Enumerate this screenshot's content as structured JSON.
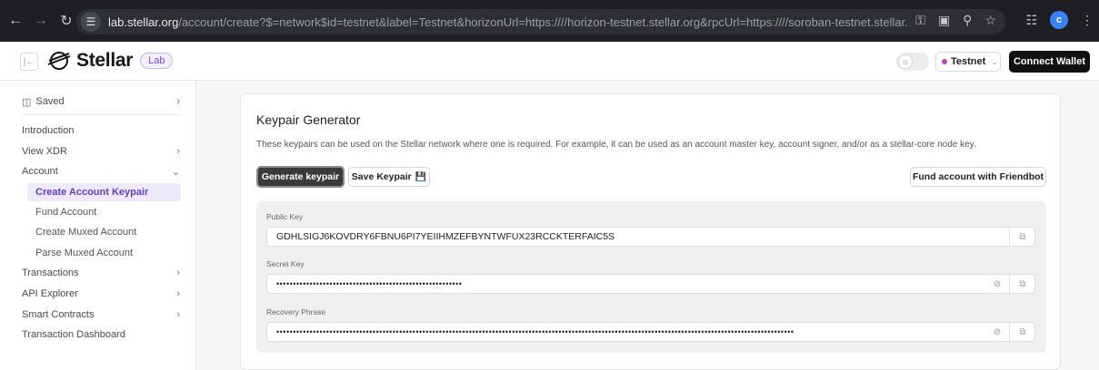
{
  "browser": {
    "url_host": "lab.stellar.org",
    "url_rest": "/account/create?$=network$id=testnet&label=Testnet&horizonUrl=https:////horizon-testnet.stellar.org&rpcUrl=https:////soroban-testnet.stellar.org&passphrase=...",
    "profile_initial": "c"
  },
  "header": {
    "logo_text": "Stellar",
    "badge": "Lab",
    "network": "Testnet",
    "connect_wallet": "Connect Wallet"
  },
  "sidebar": {
    "saved": "Saved",
    "items": [
      {
        "label": "Introduction"
      },
      {
        "label": "View XDR"
      },
      {
        "label": "Account"
      },
      {
        "label": "Transactions"
      },
      {
        "label": "API Explorer"
      },
      {
        "label": "Smart Contracts"
      },
      {
        "label": "Transaction Dashboard"
      }
    ],
    "account_sub": [
      {
        "label": "Create Account Keypair"
      },
      {
        "label": "Fund Account"
      },
      {
        "label": "Create Muxed Account"
      },
      {
        "label": "Parse Muxed Account"
      }
    ]
  },
  "card": {
    "title": "Keypair Generator",
    "description": "These keypairs can be used on the Stellar network where one is required. For example, it can be used as an account master key, account signer, and/or as a stellar-core node key.",
    "generate_button": "Generate keypair",
    "save_button": "Save Keypair",
    "fund_button": "Fund account with Friendbot",
    "public_key_label": "Public Key",
    "public_key": "GDHLSIGJ6KOVDRY6FBNU6PI7YEIIHMZEFBYNTWFUX23RCCKTERFAIC5S",
    "secret_key_label": "Secret Key",
    "secret_key_masked": "••••••••••••••••••••••••••••••••••••••••••••••••••••••••",
    "recovery_label": "Recovery Phrase",
    "recovery_masked": "••••••••••••••••••••••••••••••••••••••••••••••••••••••••••••••••••••••••••••••••••••••••••••••••••••••••••••••••••••••••••••••••••••••••••••••••••••••••••••••••••••••••••••••••••••••••••••••••••"
  },
  "icons": {
    "back": "arrow-left-icon",
    "forward": "arrow-right-icon",
    "reload": "reload-icon",
    "copy": "copy-icon",
    "eye_off": "eye-off-icon",
    "save": "save-icon",
    "saved": "saved-icon"
  }
}
